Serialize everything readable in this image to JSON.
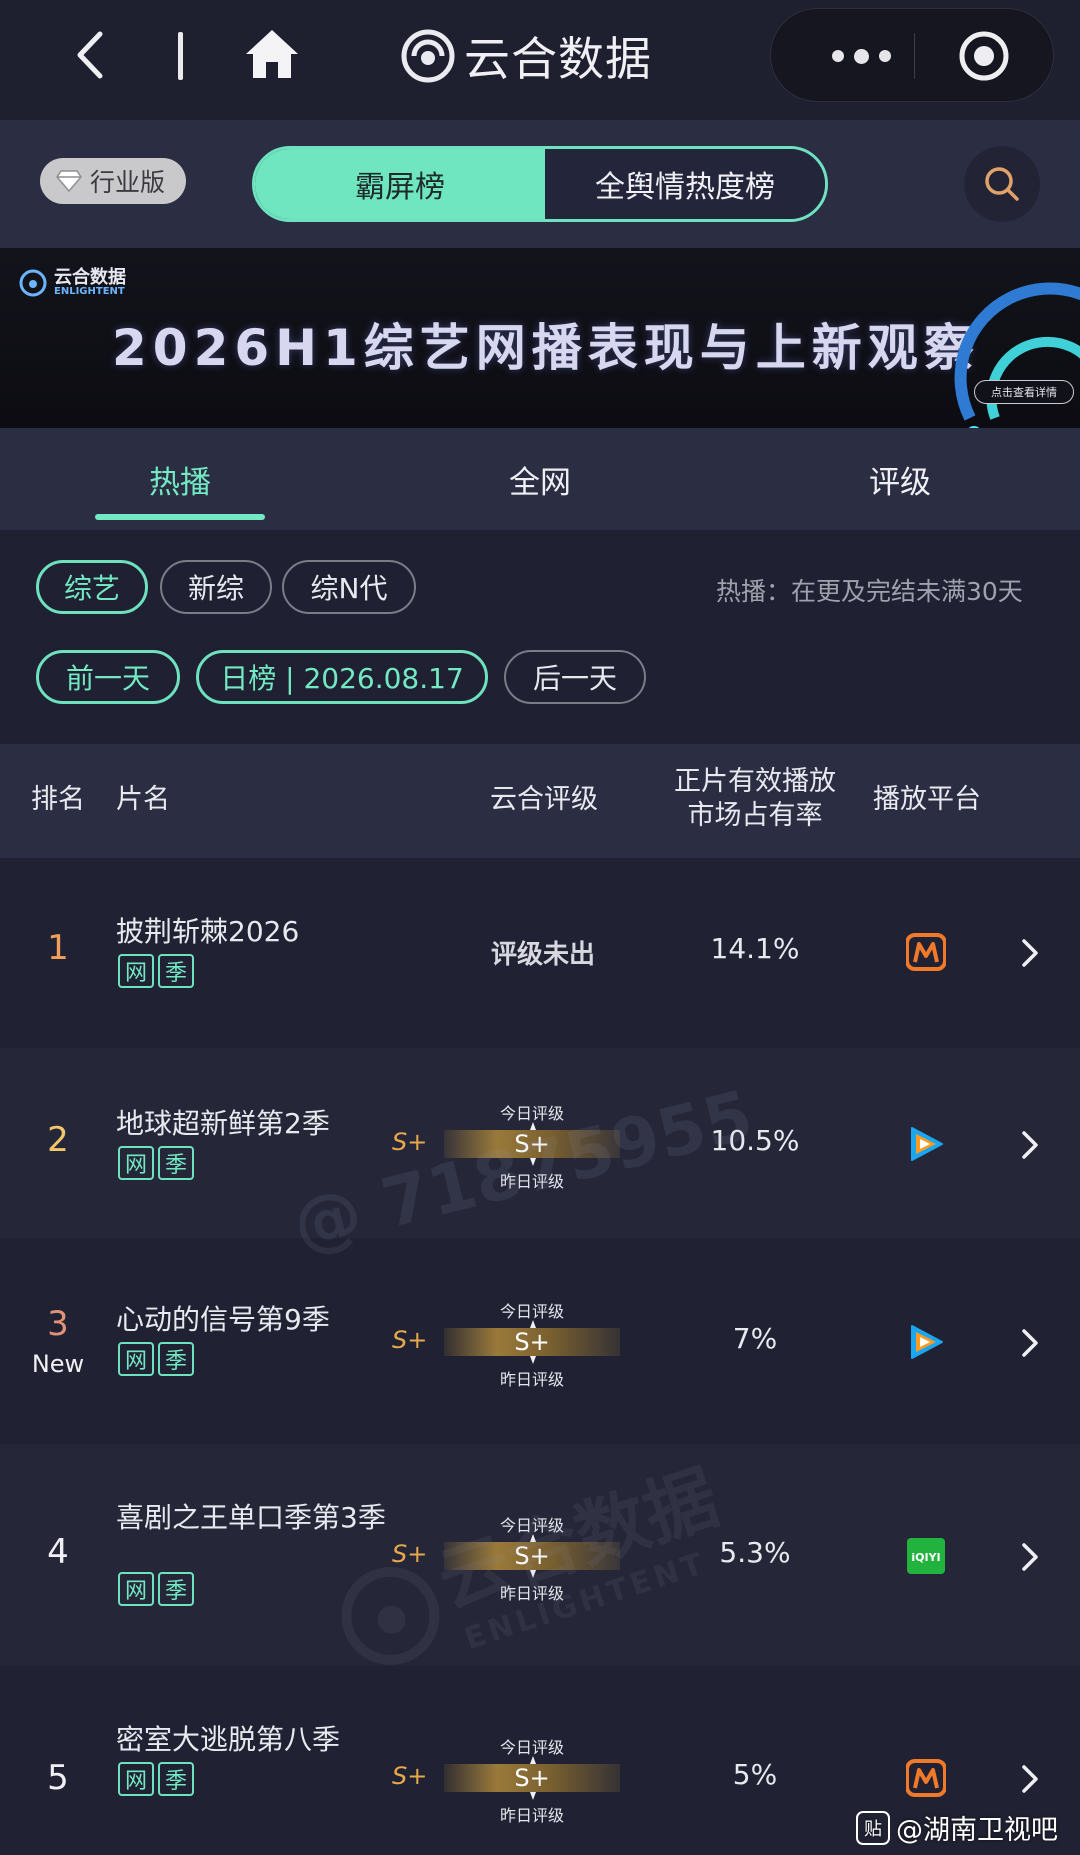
{
  "header": {
    "title": "云合数据",
    "icons": [
      "back-icon",
      "home-icon",
      "more-icon",
      "target-icon"
    ]
  },
  "filter_bar": {
    "industry_badge": "行业版",
    "segments": [
      "霸屏榜",
      "全舆情热度榜"
    ],
    "active_segment": "霸屏榜"
  },
  "banner": {
    "logo_cn": "云合数据",
    "logo_en": "ENLIGHTENT",
    "title": "2026H1综艺网播表现与上新观察",
    "cta": "点击查看详情"
  },
  "tabs": {
    "items": [
      "热播",
      "全网",
      "评级"
    ],
    "active": "热播"
  },
  "chips": {
    "category": [
      "综艺",
      "新综",
      "综N代"
    ],
    "active_category": "综艺",
    "hint": "热播：在更及完结未满30天",
    "prev_day": "前一天",
    "date": "日榜 | 2026.08.17",
    "next_day": "后一天"
  },
  "table": {
    "headers": {
      "rank": "排名",
      "title": "片名",
      "rating": "云合评级",
      "share_line1": "正片有效播放",
      "share_line2": "市场占有率",
      "platform": "播放平台"
    },
    "rows": [
      {
        "rank": "1",
        "title": "披荆斩棘2026",
        "tags": [
          "网",
          "季"
        ],
        "rating_text": "评级未出",
        "share": "14.1%",
        "platform": "mango-tv-icon"
      },
      {
        "rank": "2",
        "title": "地球超新鲜第2季",
        "tags": [
          "网",
          "季"
        ],
        "rating_prev": "S+",
        "rating_top": "今日评级",
        "rating": "S+",
        "rating_bottom": "昨日评级",
        "share": "10.5%",
        "platform": "tencent-video-icon"
      },
      {
        "rank": "3",
        "new": "New",
        "title": "心动的信号第9季",
        "tags": [
          "网",
          "季"
        ],
        "rating_prev": "S+",
        "rating_top": "今日评级",
        "rating": "S+",
        "rating_bottom": "昨日评级",
        "share": "7%",
        "platform": "tencent-video-icon"
      },
      {
        "rank": "4",
        "title": "喜剧之王单口季第3季",
        "tags": [
          "网",
          "季"
        ],
        "rating_prev": "S+",
        "rating_top": "今日评级",
        "rating": "S+",
        "rating_bottom": "昨日评级",
        "share": "5.3%",
        "platform": "iqiyi-icon"
      },
      {
        "rank": "5",
        "title": "密室大逃脱第八季",
        "tags": [
          "网",
          "季"
        ],
        "rating_prev": "S+",
        "rating_top": "今日评级",
        "rating": "S+",
        "rating_bottom": "昨日评级",
        "share": "5%",
        "platform": "mango-tv-icon"
      }
    ]
  },
  "watermarks": {
    "diagonal_text": "@ 71875955",
    "brand_cn": "云合数据",
    "brand_en": "ENLIGHTENT",
    "footer": "@湖南卫视吧",
    "footer_icon": "贴"
  },
  "colors": {
    "accent": "#73e8c3",
    "background": "#1f2132",
    "panel": "#2b2e43",
    "rating_gold": "#e8a84c"
  }
}
